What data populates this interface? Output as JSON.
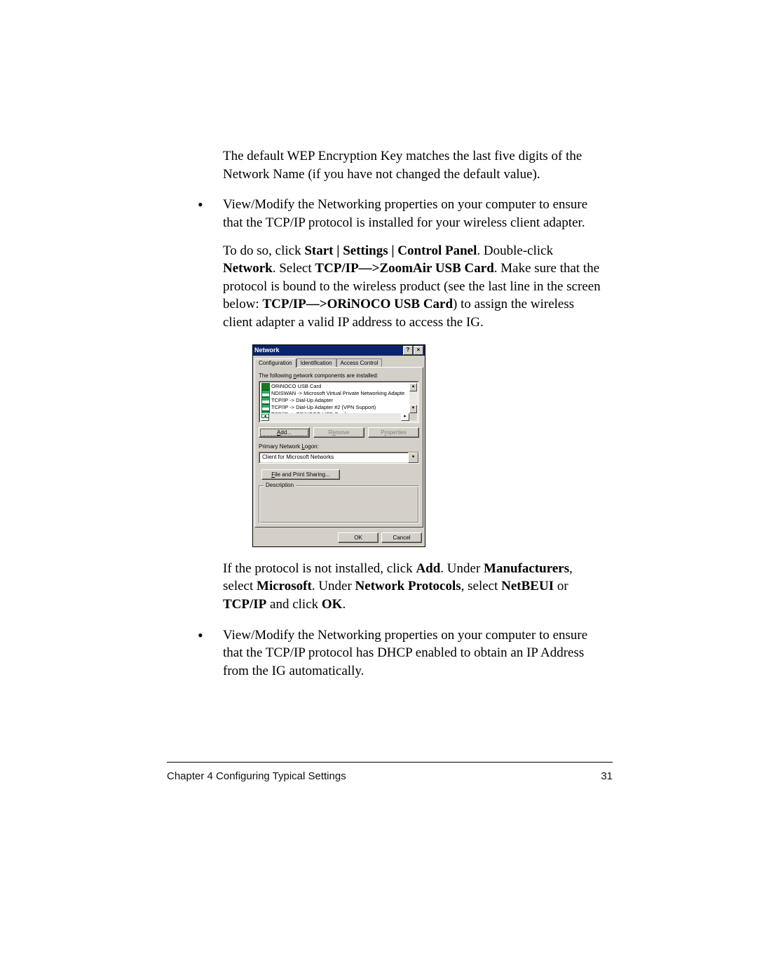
{
  "text": {
    "p1": "The default WEP Encryption Key matches the last five digits of the Network Name (if you have not changed the default value).",
    "b1": "View/Modify the Networking properties on your computer to ensure that the TCP/IP protocol is installed for your wireless client adapter.",
    "p2a": "To do so, click ",
    "p2b": "Start | Settings | Control Panel",
    "p2c": ". Double-click ",
    "p2d": "Network",
    "p2e": ". Select ",
    "p2f": "TCP/IP—>ZoomAir USB Card",
    "p2g": ". Make sure that the protocol is bound to the wireless product (see the last line in the screen below: ",
    "p2h": "TCP/IP—>ORiNOCO USB Card",
    "p2i": ") to assign the wireless client adapter a valid IP address to access the IG.",
    "p3a": "If the protocol is not installed, click ",
    "p3b": "Add",
    "p3c": ". Under ",
    "p3d": "Manufacturers",
    "p3e": ", select ",
    "p3f": "Microsoft",
    "p3g": ". Under ",
    "p3h": "Network Protocols",
    "p3i": ", select ",
    "p3j": "NetBEUI",
    "p3k": " or ",
    "p3l": "TCP/IP",
    "p3m": " and click ",
    "p3n": "OK",
    "p3o": ".",
    "b2": "View/Modify the Networking properties on your computer to ensure that the TCP/IP protocol has DHCP enabled to obtain an IP Address from the IG automatically."
  },
  "dialog": {
    "title": "Network",
    "help": "?",
    "close": "×",
    "tabs": {
      "t1": "Configuration",
      "t2": "Identification",
      "t3": "Access Control"
    },
    "list_label_a": "The following ",
    "list_label_u": "n",
    "list_label_b": "etwork components are installed:",
    "items": [
      "ORiNOCO USB Card",
      "NDISWAN -> Microsoft Virtual Private Networking Adapte",
      "TCP/IP -> Dial-Up Adapter",
      "TCP/IP -> Dial-Up Adapter #2 (VPN Support)",
      "TCP/IP -> ORiNOCO USB Card"
    ],
    "add_u": "A",
    "add": "dd...",
    "remove_pre": "R",
    "remove_u": "e",
    "remove_post": "move",
    "props_pre": "P",
    "props_u": "r",
    "props_post": "operties",
    "logon_lbl_a": "Primary Network ",
    "logon_u": "L",
    "logon_lbl_b": "ogon:",
    "logon_val": "Client for Microsoft Networks",
    "fps_u": "F",
    "fps": "ile and Print Sharing...",
    "desc": "Description",
    "ok": "OK",
    "cancel": "Cancel",
    "up": "▴",
    "down": "▾",
    "left": "◂",
    "right": "▸",
    "dd": "▾"
  },
  "footer": {
    "chapter": "Chapter 4    Configuring Typical Settings",
    "page": "31"
  }
}
